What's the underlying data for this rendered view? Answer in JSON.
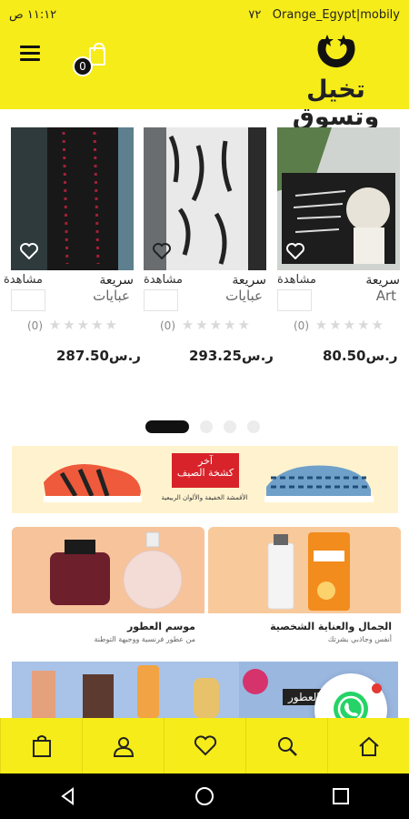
{
  "status_bar": {
    "time": "١١:١٢ ص",
    "battery": "٧٢",
    "carrier": "Orange_Egypt|mobily"
  },
  "header": {
    "logo_text": "تخيل وتسوق",
    "cart_count": "0"
  },
  "products": [
    {
      "title": "سريعة",
      "category": "Art",
      "quick_view": "مشاهدة",
      "rating_count": "(0)",
      "price": "ر.س80.50"
    },
    {
      "title": "سريعة",
      "category": "عبايات",
      "quick_view": "مشاهدة",
      "rating_count": "(0)",
      "price": "ر.س293.25"
    },
    {
      "title": "سريعة",
      "category": "عبايات",
      "quick_view": "مشاهدة",
      "rating_count": "(0)",
      "price": "ر.س287.50"
    }
  ],
  "carousel": {
    "active_index": 0,
    "total": 4
  },
  "banner": {
    "headline_1": "آخر",
    "headline_2": "كشخة الصيف",
    "subtitle": "الأقمشة الخفيفة والألوان الربيعية"
  },
  "promos": [
    {
      "title": "الجمال والعناية الشخصية",
      "subtitle": "أنفس وجاذبي بشرتك"
    },
    {
      "title": "موسم العطور",
      "subtitle": "من عطور فرنسية ووجيهة التوطنة"
    }
  ],
  "strip": {
    "label": "العطور"
  },
  "colors": {
    "brand_yellow": "#f6ec19",
    "whatsapp_green": "#25d366",
    "badge_red": "#e53935"
  },
  "navbar_icons": [
    "bag-icon",
    "user-icon",
    "heart-icon",
    "search-icon",
    "home-icon"
  ]
}
